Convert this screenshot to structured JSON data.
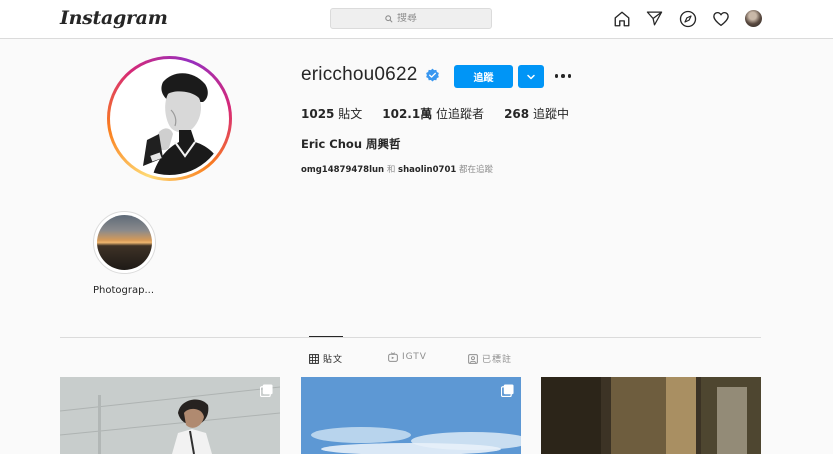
{
  "header": {
    "logo": "Instagram",
    "search": {
      "placeholder": "搜尋"
    },
    "nav_icons": [
      "home-icon",
      "direct-messages-icon",
      "explore-compass-icon",
      "activity-heart-icon",
      "profile-avatar"
    ]
  },
  "profile": {
    "username": "ericchou0622",
    "verified": true,
    "follow_label": "追蹤",
    "full_name": "Eric Chou 周興哲",
    "stats": [
      {
        "value": "1025",
        "label": "貼文"
      },
      {
        "value": "102.1萬",
        "label": "位追蹤者"
      },
      {
        "value": "268",
        "label": "追蹤中"
      }
    ],
    "followed_by": {
      "user1": "omg14879478lun",
      "connector": "和",
      "user2": "shaolin0701",
      "suffix": "都在追蹤"
    }
  },
  "highlights": [
    {
      "label": "Photograp..."
    }
  ],
  "tabs": [
    {
      "label": "貼文",
      "icon": "grid-icon",
      "active": true
    },
    {
      "label": "IGTV",
      "icon": "igtv-icon",
      "active": false
    },
    {
      "label": "已標註",
      "icon": "tagged-icon",
      "active": false
    }
  ],
  "colors": {
    "accent": "#0095f6",
    "background": "#fafafa",
    "text": "#262626",
    "secondary_text": "#8e8e8e",
    "border": "#dbdbdb"
  }
}
